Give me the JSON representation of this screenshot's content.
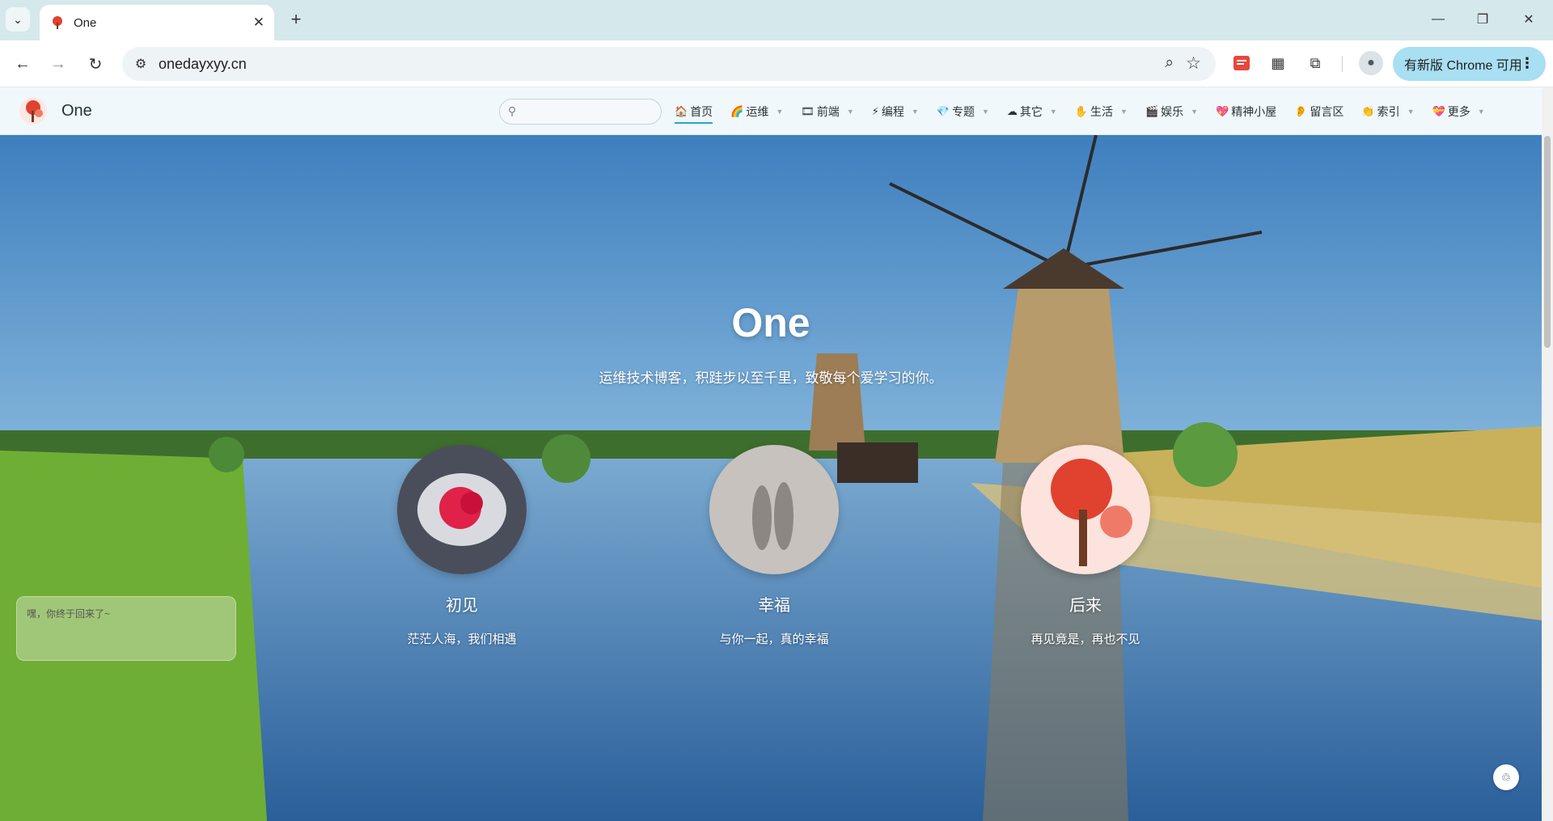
{
  "browser": {
    "tab_title": "One",
    "url": "onedayxyy.cn",
    "update_label": "有新版 Chrome 可用"
  },
  "site": {
    "name": "One",
    "search_placeholder": "",
    "nav": [
      {
        "icon": "🏠",
        "label": "首页",
        "caret": false,
        "active": true
      },
      {
        "icon": "🌈",
        "label": "运维",
        "caret": true
      },
      {
        "icon": "🎞",
        "label": "前端",
        "caret": true
      },
      {
        "icon": "⚡",
        "label": "编程",
        "caret": true
      },
      {
        "icon": "💎",
        "label": "专题",
        "caret": true
      },
      {
        "icon": "☁",
        "label": "其它",
        "caret": true
      },
      {
        "icon": "✋",
        "label": "生活",
        "caret": true
      },
      {
        "icon": "🎬",
        "label": "娱乐",
        "caret": true
      },
      {
        "icon": "💖",
        "label": "精神小屋",
        "caret": false
      },
      {
        "icon": "👂",
        "label": "留言区",
        "caret": false
      },
      {
        "icon": "👏",
        "label": "索引",
        "caret": true
      },
      {
        "icon": "💝",
        "label": "更多",
        "caret": true
      }
    ]
  },
  "hero": {
    "title": "One",
    "subtitle": "运维技术博客，积跬步以至千里，致敬每个爱学习的你。",
    "cards": [
      {
        "title": "初见",
        "subtitle": "茫茫人海，我们相遇"
      },
      {
        "title": "幸福",
        "subtitle": "与你一起，真的幸福"
      },
      {
        "title": "后来",
        "subtitle": "再见竟是，再也不见"
      }
    ]
  },
  "chat": {
    "text": "嘿，你终于回来了~"
  },
  "colors": {
    "accent": "#2aa5c7",
    "chrome_frame": "#d5e8ec",
    "update_pill": "#a8dff2"
  }
}
